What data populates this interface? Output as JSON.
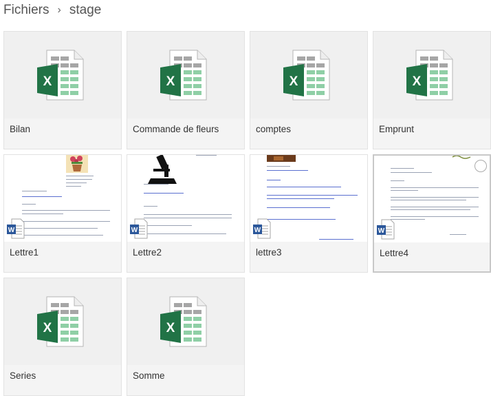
{
  "breadcrumb": {
    "root": "Fichiers",
    "separator": "›",
    "current": "stage"
  },
  "icons": {
    "excel_color": "#217346",
    "word_color": "#2b579a"
  },
  "files": [
    {
      "name": "Bilan",
      "type": "excel"
    },
    {
      "name": "Commande de fleurs",
      "type": "excel"
    },
    {
      "name": "comptes",
      "type": "excel"
    },
    {
      "name": "Emprunt",
      "type": "excel"
    },
    {
      "name": "Lettre1",
      "type": "word"
    },
    {
      "name": "Lettre2",
      "type": "word"
    },
    {
      "name": "lettre3",
      "type": "word"
    },
    {
      "name": "Lettre4",
      "type": "word",
      "selected": true
    },
    {
      "name": "Series",
      "type": "excel"
    },
    {
      "name": "Somme",
      "type": "excel"
    }
  ]
}
